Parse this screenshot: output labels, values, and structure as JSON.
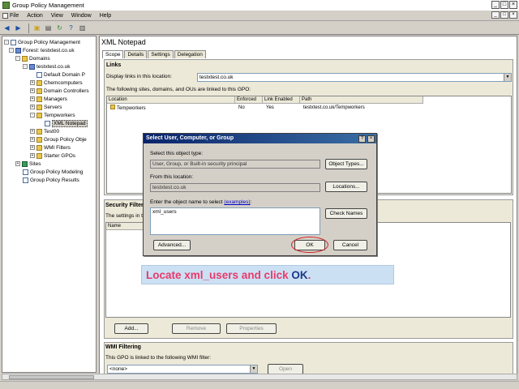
{
  "window": {
    "title": "Group Policy Management",
    "min": "_",
    "max": "□",
    "close": "×"
  },
  "menu": [
    "File",
    "Action",
    "View",
    "Window",
    "Help"
  ],
  "tree": [
    {
      "label": "Group Policy Management",
      "icon": "gpm-icon"
    },
    {
      "label": "Forest: testxtest.co.uk",
      "icon": "forest-icon"
    },
    {
      "label": "Domains",
      "icon": "folder-icon"
    },
    {
      "label": "testxtest.co.uk",
      "icon": "domain-icon"
    },
    {
      "label": "Default Domain P",
      "icon": "gpo-icon"
    },
    {
      "label": "Chemcomputers",
      "icon": "folder-icon"
    },
    {
      "label": "Domain Controllers",
      "icon": "folder-icon"
    },
    {
      "label": "Managers",
      "icon": "folder-icon"
    },
    {
      "label": "Servers",
      "icon": "folder-icon"
    },
    {
      "label": "Tempworkers",
      "icon": "folder-icon"
    },
    {
      "label": "XML Notepad",
      "icon": "gpo-icon"
    },
    {
      "label": "Test00",
      "icon": "folder-icon"
    },
    {
      "label": "Group Policy Obje",
      "icon": "folder-icon"
    },
    {
      "label": "WMI Filters",
      "icon": "folder-icon"
    },
    {
      "label": "Starter GPOs",
      "icon": "folder-icon"
    },
    {
      "label": "Sites",
      "icon": "site-icon"
    },
    {
      "label": "Group Policy Modeling",
      "icon": "modeling-icon"
    },
    {
      "label": "Group Policy Results",
      "icon": "results-icon"
    }
  ],
  "pane": {
    "title": "XML Notepad",
    "tabs": [
      "Scope",
      "Details",
      "Settings",
      "Delegation"
    ],
    "links_header": "Links",
    "display_links_label": "Display links in this location:",
    "location_value": "testxtest.co.uk",
    "links_note": "The following sites, domains, and OUs are linked to this GPO:",
    "links_columns": [
      "Location",
      "Enforced",
      "Link Enabled",
      "Path"
    ],
    "links_rows": [
      {
        "location": "Tempworkers",
        "enforced": "No",
        "enabled": "Yes",
        "path": "testxtest.co.uk/Tempworkers"
      }
    ],
    "security_header": "Security Filtering",
    "security_note": "The settings in this GPO can only apply to the following groups, users, and computers:",
    "security_columns": [
      "Name"
    ],
    "add_label": "Add...",
    "remove_label": "Remove",
    "properties_label": "Properties",
    "wmi_header": "WMI Filtering",
    "wmi_note": "This GPO is linked to the following WMI filter:",
    "wmi_value": "<none>",
    "open_label": "Open"
  },
  "dialog": {
    "title": "Select User, Computer, or Group",
    "help": "?",
    "close": "×",
    "object_type_label": "Select this object type:",
    "object_type_value": "User, Group, or Built-in security principal",
    "object_types_button": "Object Types...",
    "location_label": "From this location:",
    "location_value": "testxtest.co.uk",
    "locations_button": "Locations...",
    "enter_label": "Enter the object name to select",
    "examples_link": "(examples)",
    "enter_suffix": ":",
    "object_name": "xml_users",
    "check_names_button": "Check Names",
    "advanced_button": "Advanced...",
    "ok_button": "OK",
    "cancel_button": "Cancel"
  },
  "instruction": {
    "part1": "Locate xml_users and click ",
    "part2": "OK",
    "part3": "."
  }
}
